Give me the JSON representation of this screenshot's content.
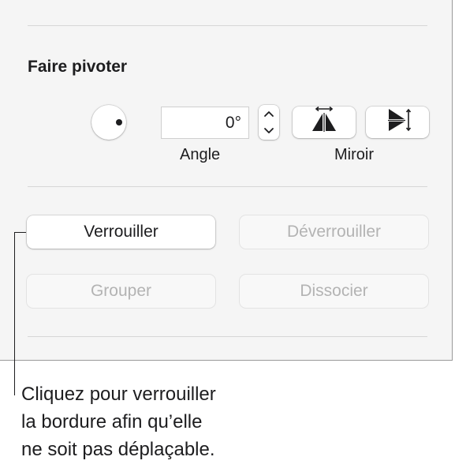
{
  "rotate": {
    "title": "Faire pivoter",
    "angle_value": "0°",
    "angle_label": "Angle",
    "mirror_label": "Miroir"
  },
  "arrange": {
    "lock_label": "Verrouiller",
    "unlock_label": "Déverrouiller",
    "group_label": "Grouper",
    "ungroup_label": "Dissocier"
  },
  "callout": {
    "lines": [
      "Cliquez pour verrouiller",
      "la bordure afin qu’elle",
      "ne soit pas déplaçable."
    ]
  },
  "icons": {
    "rotate_dial": "rotate-dial-icon",
    "stepper_up": "chevron-up-icon",
    "stepper_down": "chevron-down-icon",
    "flip_horizontal": "flip-horizontal-icon",
    "flip_vertical": "flip-vertical-icon"
  },
  "colors": {
    "panel_background": "#f5f5f5",
    "button_background": "#ffffff",
    "disabled_text": "#b3b3b3",
    "text": "#1d1d1f"
  }
}
